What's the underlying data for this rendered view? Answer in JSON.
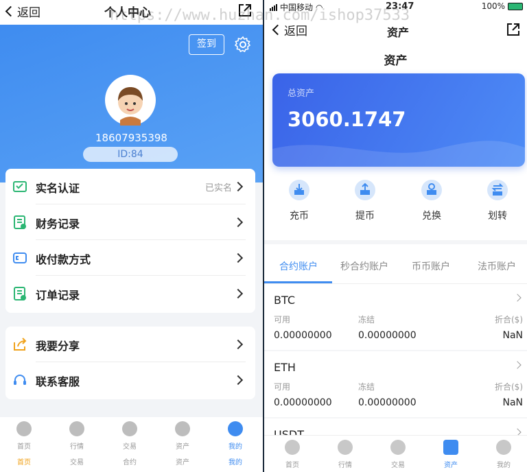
{
  "left": {
    "back_label": "返回",
    "title": "个人中心",
    "checkin_label": "签到",
    "phone": "18607935398",
    "user_id": "ID:84",
    "menu_group1": [
      {
        "label": "实名认证",
        "status": "已实名",
        "icon": "id-card-icon"
      },
      {
        "label": "财务记录",
        "icon": "finance-record-icon"
      },
      {
        "label": "收付款方式",
        "icon": "wallet-icon"
      },
      {
        "label": "订单记录",
        "icon": "order-record-icon"
      }
    ],
    "menu_group2": [
      {
        "label": "我要分享",
        "icon": "share-icon"
      },
      {
        "label": "联系客服",
        "icon": "headset-icon"
      }
    ],
    "tabbar": [
      {
        "label": "首页",
        "sub": "首页",
        "icon": "home-icon"
      },
      {
        "label": "行情",
        "sub": "交易",
        "icon": "market-icon"
      },
      {
        "label": "交易",
        "sub": "合约",
        "icon": "trade-icon"
      },
      {
        "label": "资产",
        "sub": "资产",
        "icon": "wallet-icon"
      },
      {
        "label": "我的",
        "sub": "我的",
        "icon": "user-icon",
        "active": true
      }
    ]
  },
  "watermark": "https://www.huzhan.com/ishop37533",
  "right": {
    "status_carrier": "中国移动",
    "status_time": "23:47",
    "status_battery": "100%",
    "back_label": "返回",
    "title": "资产",
    "subtitle": "资产",
    "card_label": "总资产",
    "total_assets": "3060.1747",
    "actions": [
      {
        "label": "充币",
        "icon": "deposit-icon"
      },
      {
        "label": "提币",
        "icon": "withdraw-icon"
      },
      {
        "label": "兑换",
        "icon": "exchange-icon"
      },
      {
        "label": "划转",
        "icon": "transfer-icon"
      }
    ],
    "account_tabs": [
      "合约账户",
      "秒合约账户",
      "币币账户",
      "法币账户"
    ],
    "coin_headers": {
      "available": "可用",
      "frozen": "冻结",
      "converted": "折合($)"
    },
    "coins": [
      {
        "name": "BTC",
        "available": "0.00000000",
        "frozen": "0.00000000",
        "converted": "NaN"
      },
      {
        "name": "ETH",
        "available": "0.00000000",
        "frozen": "0.00000000",
        "converted": "NaN"
      },
      {
        "name": "USDT"
      }
    ],
    "tabbar": [
      {
        "label": "首页",
        "icon": "home-icon"
      },
      {
        "label": "行情",
        "icon": "market-icon"
      },
      {
        "label": "交易",
        "icon": "trade-icon"
      },
      {
        "label": "资产",
        "icon": "wallet-icon",
        "active": true
      },
      {
        "label": "我的",
        "icon": "user-icon"
      }
    ]
  },
  "colors": {
    "accent": "#3f8cf0",
    "card_gradient_start": "#3a63e8",
    "card_gradient_end": "#4e8cf6"
  }
}
